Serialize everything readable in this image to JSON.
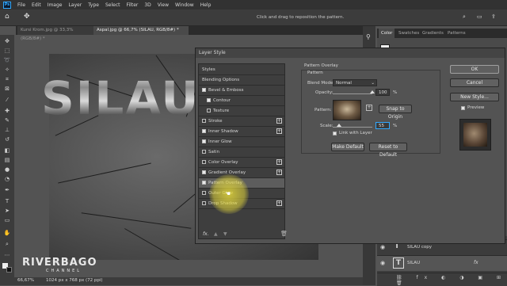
{
  "menu": [
    "File",
    "Edit",
    "Image",
    "Layer",
    "Type",
    "Select",
    "Filter",
    "3D",
    "View",
    "Window",
    "Help"
  ],
  "options_hint": "Click and drag to reposition the pattern.",
  "doc_tabs": [
    {
      "label": "Kursi Krom.jpg @ 33,3% (RGB/8#) *",
      "active": false
    },
    {
      "label": "Aspal.jpg @ 66,7% (SILAU, RGB/8#) *",
      "active": true
    }
  ],
  "canvas_text": "SILAU",
  "watermark": {
    "main": "RIVERBAGO",
    "sub": "CHANNEL"
  },
  "status": {
    "zoom": "66,67%",
    "doc_size": "1024 px x 768 px (72 ppi)"
  },
  "panel_tabs": [
    "Color",
    "Swatches",
    "Gradients",
    "Patterns"
  ],
  "layers": [
    {
      "name": "SILAU copy",
      "fx": false
    },
    {
      "name": "SILAU",
      "fx": true
    }
  ],
  "dialog": {
    "title": "Layer Style",
    "styles_header": "Styles",
    "blending": "Blending Options",
    "items": [
      {
        "label": "Bevel & Emboss",
        "checked": true,
        "plus": false,
        "indent": false
      },
      {
        "label": "Contour",
        "checked": true,
        "plus": false,
        "indent": true
      },
      {
        "label": "Texture",
        "checked": false,
        "plus": false,
        "indent": true
      },
      {
        "label": "Stroke",
        "checked": false,
        "plus": true,
        "indent": false
      },
      {
        "label": "Inner Shadow",
        "checked": true,
        "plus": true,
        "indent": false
      },
      {
        "label": "Inner Glow",
        "checked": true,
        "plus": false,
        "indent": false
      },
      {
        "label": "Satin",
        "checked": false,
        "plus": false,
        "indent": false
      },
      {
        "label": "Color Overlay",
        "checked": false,
        "plus": true,
        "indent": false
      },
      {
        "label": "Gradient Overlay",
        "checked": true,
        "plus": true,
        "indent": false
      },
      {
        "label": "Pattern Overlay",
        "checked": true,
        "plus": false,
        "indent": false,
        "active": true
      },
      {
        "label": "Outer Glow",
        "checked": false,
        "plus": false,
        "indent": false
      },
      {
        "label": "Drop Shadow",
        "checked": false,
        "plus": true,
        "indent": false
      }
    ],
    "section_title": "Pattern Overlay",
    "group_title": "Pattern",
    "blend_mode_label": "Blend Mode:",
    "blend_mode_value": "Normal",
    "opacity_label": "Opacity:",
    "opacity_value": "100",
    "percent": "%",
    "pattern_label": "Pattern:",
    "snap_label": "Snap to Origin",
    "scale_label": "Scale:",
    "scale_value": "55",
    "scale_percent": 0.55,
    "opacity_percent": 1.0,
    "link_label": "Link with Layer",
    "make_default": "Make Default",
    "reset_default": "Reset to Default",
    "ok": "OK",
    "cancel": "Cancel",
    "new_style": "New Style...",
    "preview": "Preview",
    "fx_label": "fx."
  },
  "colors": {
    "accent": "#31a8ff",
    "highlight": "#e2d63c",
    "panel": "#535353"
  }
}
